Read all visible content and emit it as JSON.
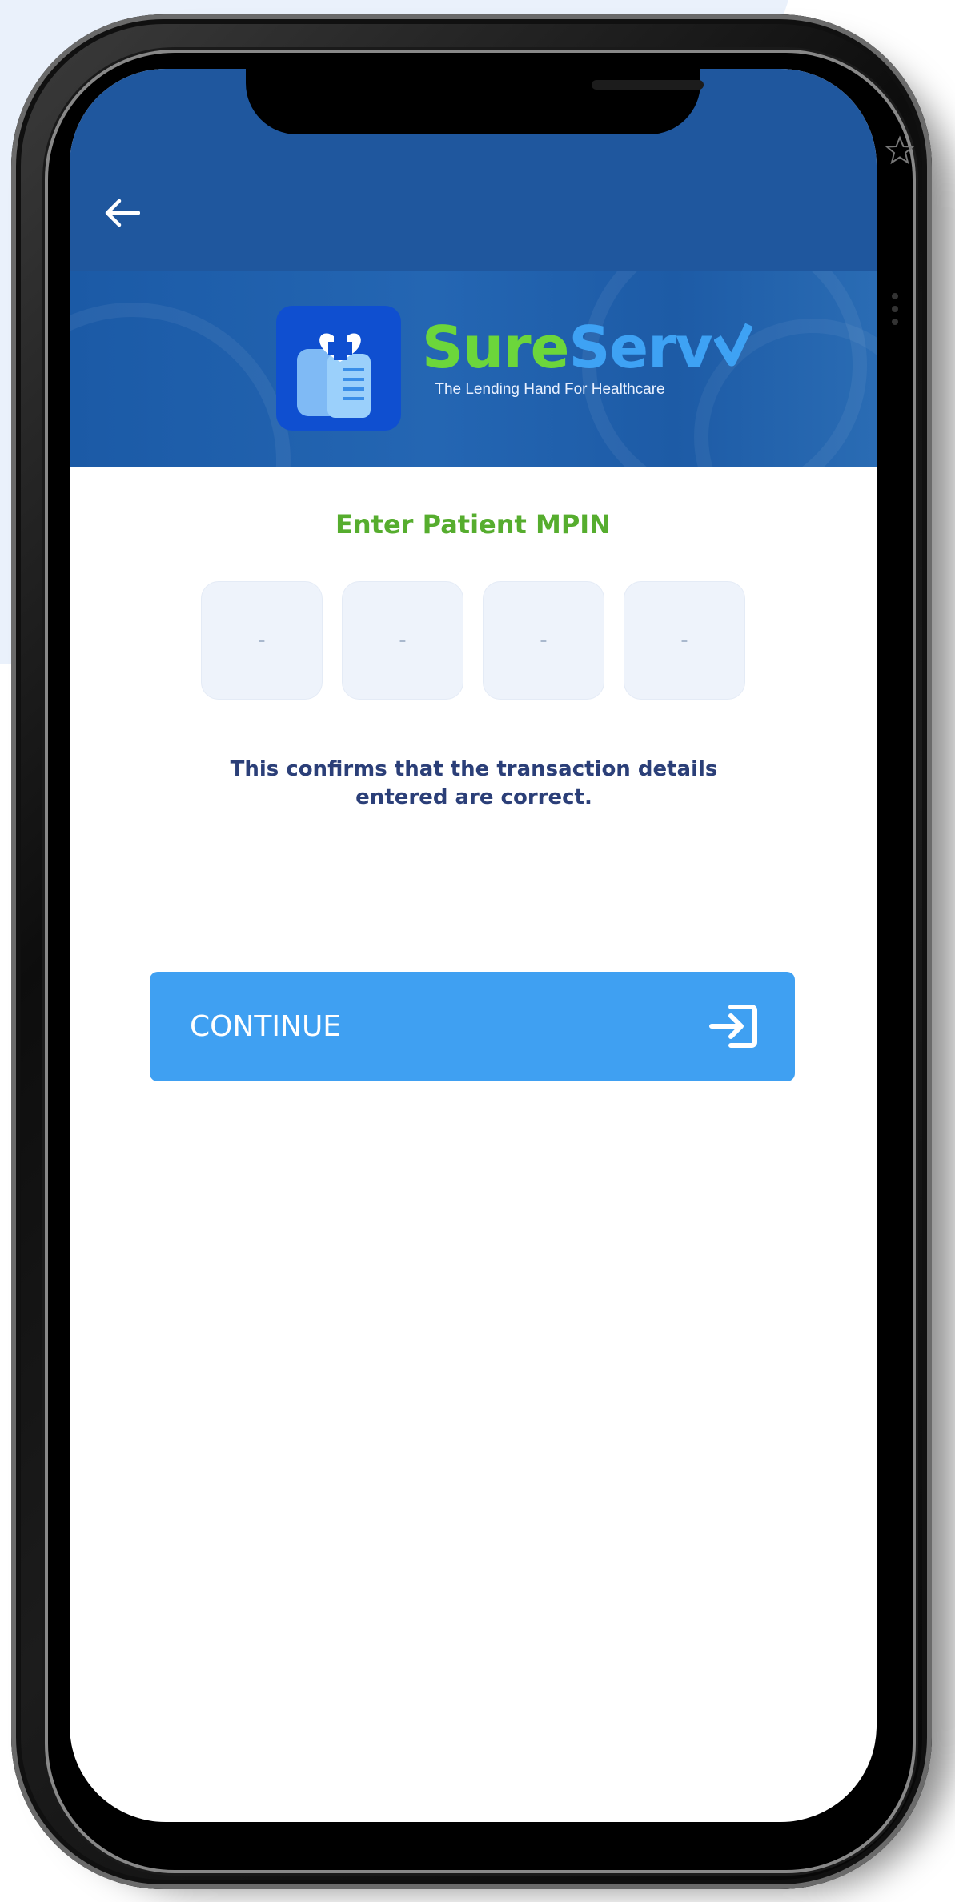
{
  "app": {
    "brand_part1": "Sure",
    "brand_part2": "Serv",
    "tagline": "The Lending Hand For Healthcare"
  },
  "header": {
    "back_icon": "arrow-left-icon",
    "logo_icon": "sureserv-logo-icon"
  },
  "mpin": {
    "title": "Enter Patient MPIN",
    "digits": [
      "-",
      "-",
      "-",
      "-"
    ]
  },
  "confirmation": {
    "line1": "This confirms that the transaction details",
    "line2": "entered are correct."
  },
  "actions": {
    "continue_label": "CONTINUE",
    "continue_icon": "sign-in-icon"
  },
  "colors": {
    "appbar": "#1f579e",
    "title_green": "#56ad2e",
    "button_blue": "#3fa0f2",
    "text_navy": "#2b3f78"
  }
}
